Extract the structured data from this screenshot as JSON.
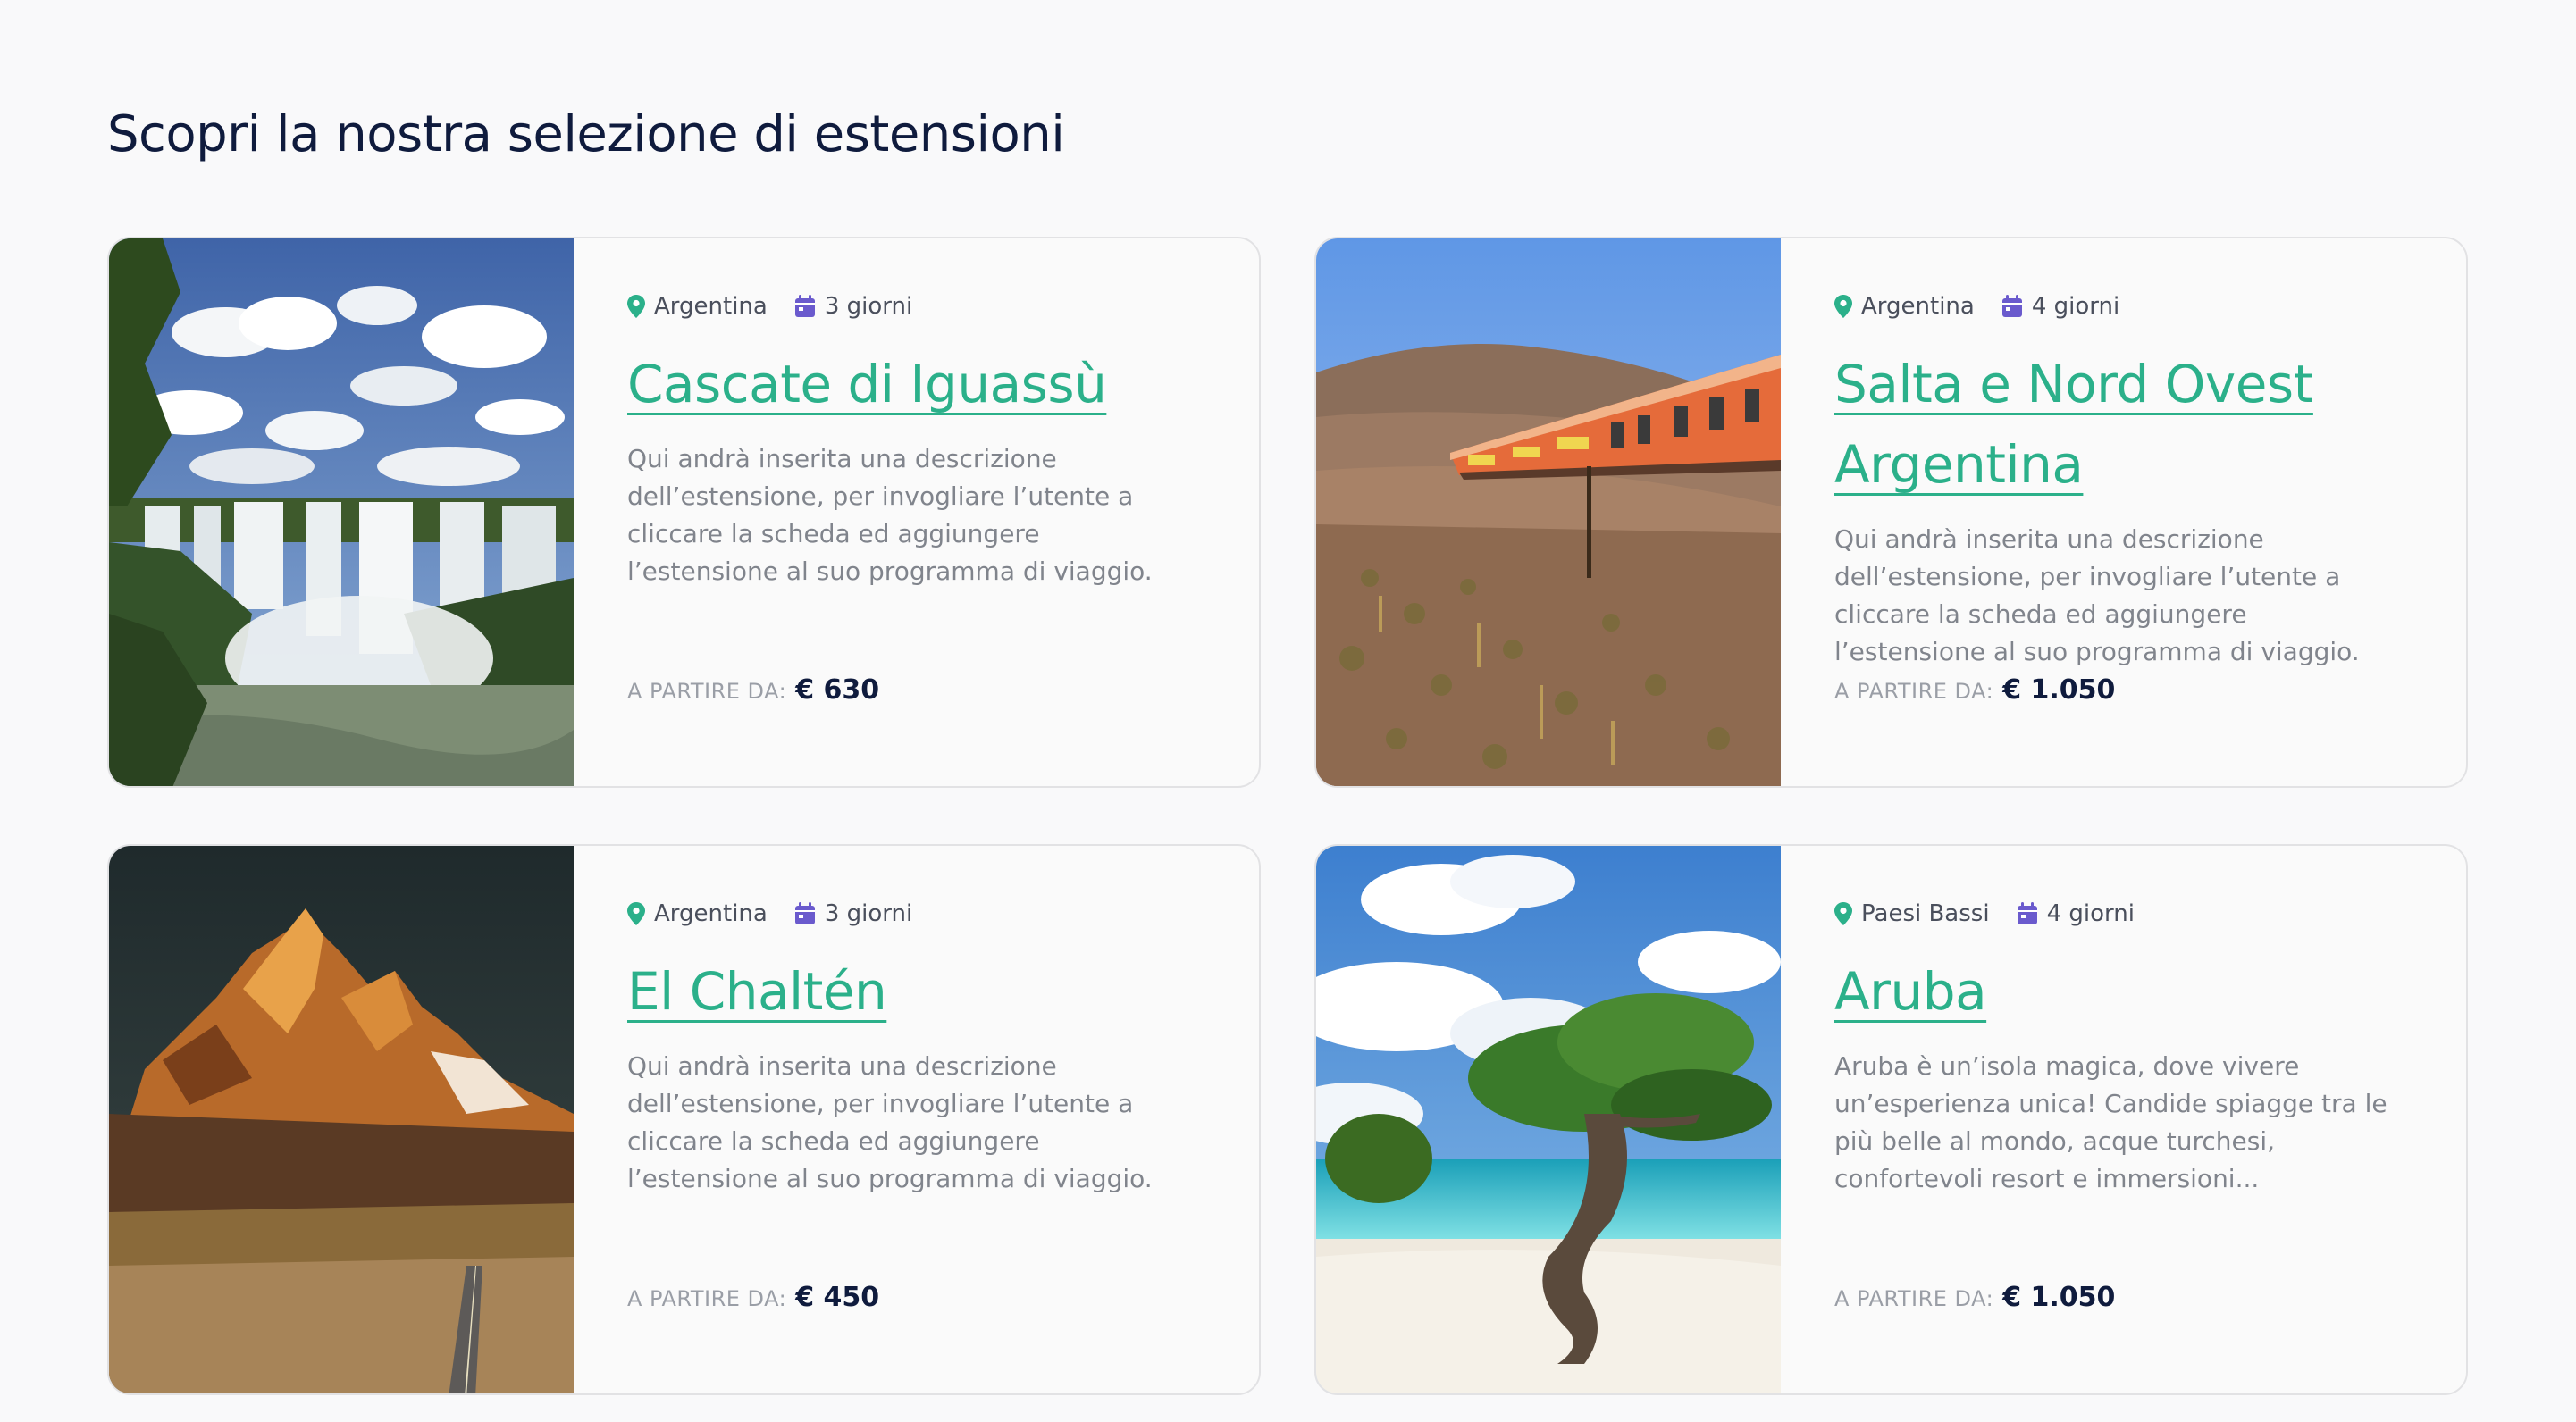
{
  "page": {
    "title": "Scopri la nostra selezione di estensioni"
  },
  "colors": {
    "background": "#f9f9fa",
    "title_accent": "#2bb08a",
    "location_icon": "#2bb08a",
    "calendar_icon": "#6a5acd",
    "text_dark": "#0f1b3d",
    "text_muted": "#80848c"
  },
  "cards": [
    {
      "location": "Argentina",
      "duration": "3 giorni",
      "title": "Cascate di Iguassù",
      "description": "Qui andrà inserita una descrizione dell’estensione, per invogliare l’utente a cliccare la scheda ed aggiungere l’estensione al suo programma di viaggio.",
      "price_label": "A PARTIRE DA:",
      "price": "€ 630",
      "image": "waterfall-photo"
    },
    {
      "location": "Argentina",
      "duration": "4 giorni",
      "title": "Salta e Nord Ovest Argentina",
      "description": "Qui andrà inserita una descrizione dell’estensione, per invogliare l’utente a cliccare la scheda ed aggiungere l’estensione al suo programma di viaggio.",
      "price_label": "A PARTIRE DA:",
      "price": "€ 1.050",
      "image": "train-desert-photo"
    },
    {
      "location": "Argentina",
      "duration": "3 giorni",
      "title": "El Chaltén",
      "description": "Qui andrà inserita una descrizione dell’estensione, per invogliare l’utente a cliccare la scheda ed aggiungere l’estensione al suo programma di viaggio.",
      "price_label": "A PARTIRE DA:",
      "price": "€ 450",
      "image": "mountain-road-photo"
    },
    {
      "location": "Paesi Bassi",
      "duration": "4 giorni",
      "title": "Aruba",
      "description": "Aruba è un’isola magica, dove vivere un’esperienza unica! Candide spiagge tra le più belle al mondo, acque turchesi, confortevoli resort e immersioni...",
      "price_label": "A PARTIRE DA:",
      "price": "€ 1.050",
      "image": "beach-tree-photo"
    }
  ]
}
